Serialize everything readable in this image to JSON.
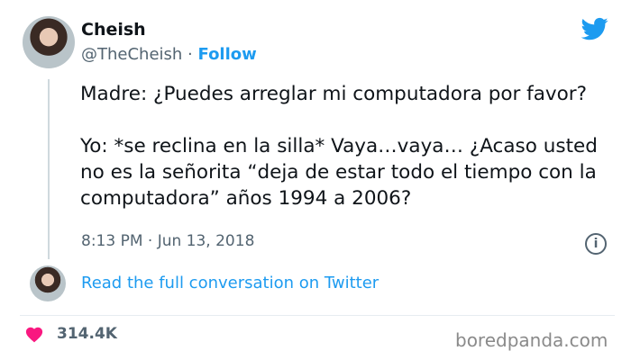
{
  "user": {
    "display_name": "Cheish",
    "handle": "@TheCheish",
    "separator": " · ",
    "follow_label": "Follow"
  },
  "tweet": {
    "text": "Madre: ¿Puedes arreglar mi computadora por favor?\n\nYo: *se reclina en la silla* Vaya…vaya… ¿Acaso usted no es la señorita “deja de estar todo el tiempo con la computadora” años 1994 a 2006?",
    "timestamp": "8:13 PM · Jun 13, 2018"
  },
  "conversation_link": "Read the full conversation on Twitter",
  "likes": "314.4K",
  "watermark": "boredpanda.com",
  "colors": {
    "accent": "#1d9bf0",
    "heart": "#f91880",
    "muted": "#536471"
  },
  "icons": {
    "brand": "twitter-bird-icon",
    "info": "info-icon",
    "like": "heart-icon"
  }
}
